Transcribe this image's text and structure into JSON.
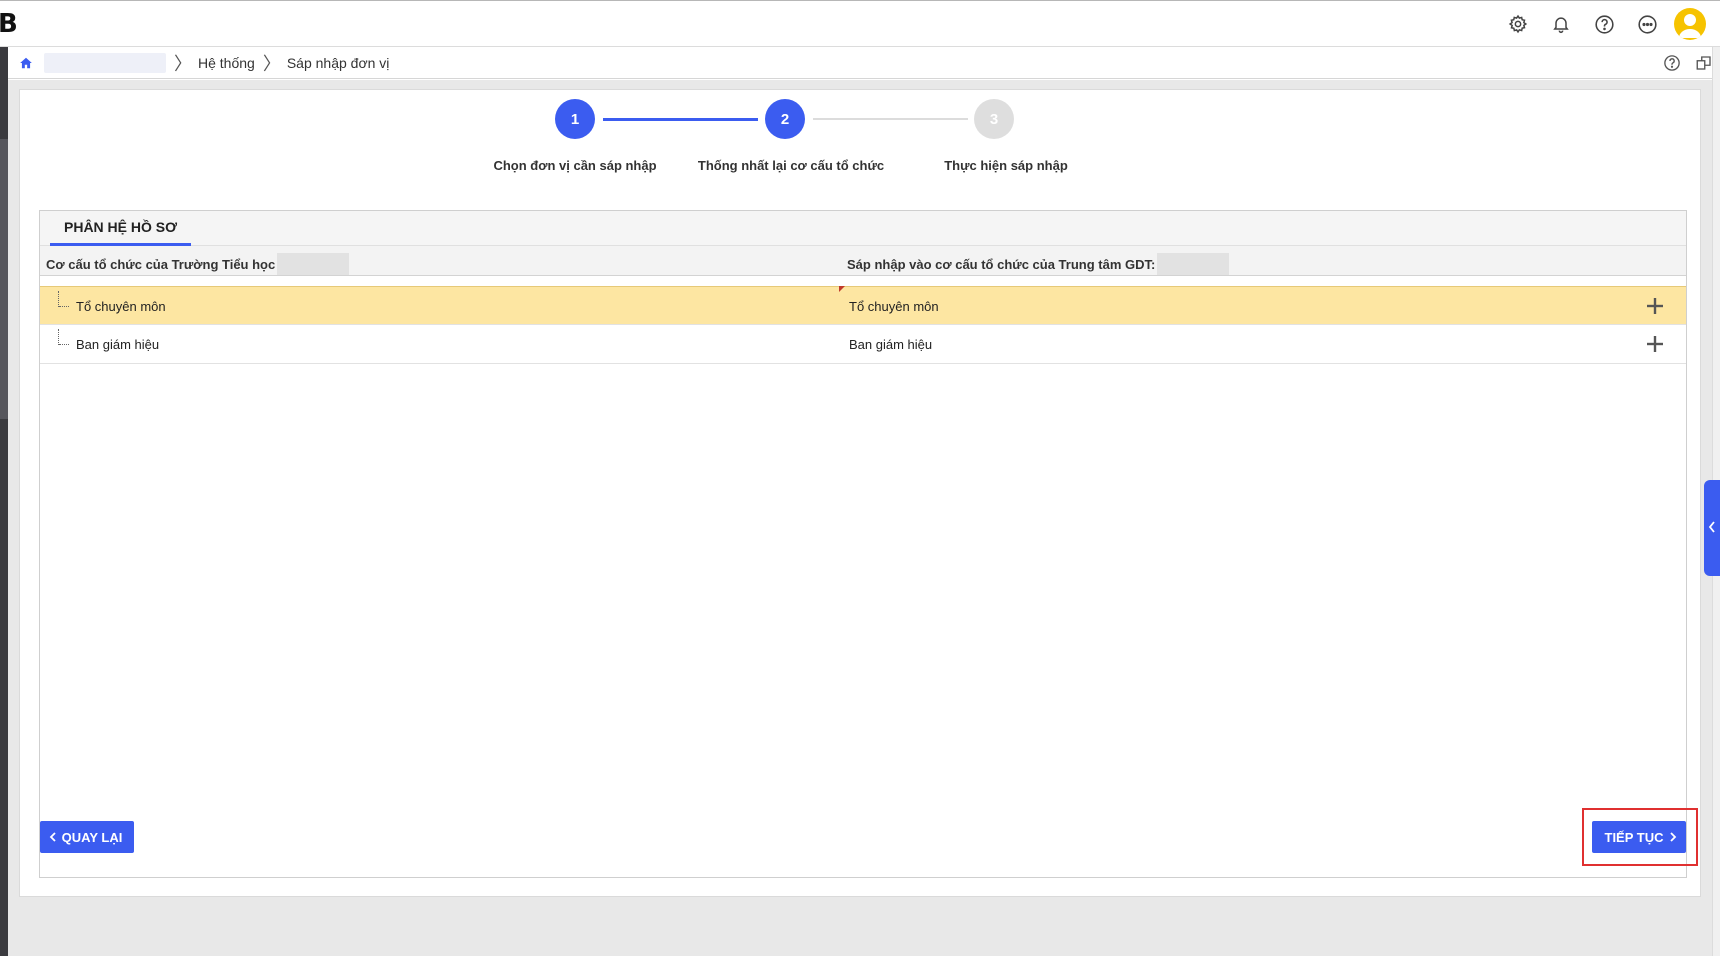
{
  "app": {
    "logo_text": "B"
  },
  "topbar": {
    "icons": [
      "gear-icon",
      "bell-icon",
      "help-icon",
      "more-icon",
      "user-avatar-icon"
    ]
  },
  "breadcrumb": {
    "items": [
      "Hệ thống",
      "Sáp nhập đơn vị"
    ]
  },
  "stepper": {
    "steps": [
      {
        "number": "1",
        "label": "Chọn đơn vị cần sáp nhập",
        "state": "active"
      },
      {
        "number": "2",
        "label": "Thống nhất lại cơ cấu tổ chức",
        "state": "active"
      },
      {
        "number": "3",
        "label": "Thực hiện sáp nhập",
        "state": "inactive"
      }
    ]
  },
  "tab": {
    "label": "PHÂN HỆ HỒ SƠ"
  },
  "table": {
    "headers": {
      "source": "Cơ cấu tổ chức của Trường Tiểu học",
      "target": "Sáp nhập vào cơ cấu tổ chức của Trung tâm GDT:"
    },
    "rows": [
      {
        "source": "Tổ chuyên môn",
        "target": "Tổ chuyên môn",
        "selected": true
      },
      {
        "source": "Ban giám hiệu",
        "target": "Ban giám hiệu",
        "selected": false
      }
    ]
  },
  "footer": {
    "back_label": "QUAY LẠI",
    "next_label": "TIẾP TỤC"
  },
  "colors": {
    "accent": "#3b5cf0",
    "selected_row": "#fde6a2",
    "highlight_box": "#e03030"
  }
}
